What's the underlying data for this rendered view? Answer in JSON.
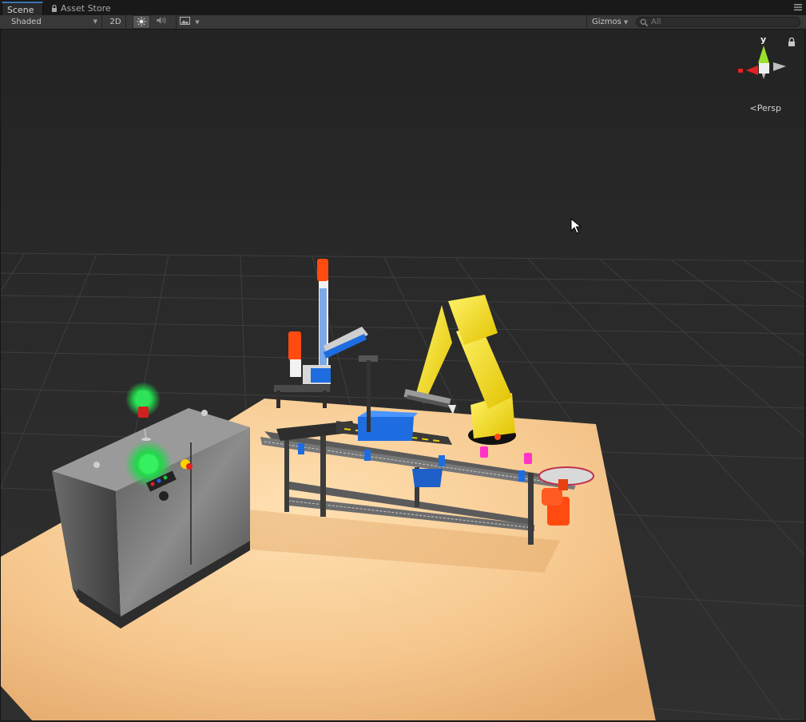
{
  "tabs": {
    "scene": "Scene",
    "asset_store": "Asset Store"
  },
  "toolbar": {
    "shading_mode": "Shaded",
    "mode_2d": "2D",
    "gizmos": "Gizmos",
    "search_placeholder": "All"
  },
  "scene_gizmo": {
    "axis_label": "y",
    "projection": "Persp"
  },
  "colors": {
    "robot": "#f5e000",
    "accent_orange": "#ff4a10",
    "bin_blue": "#1e6de0",
    "floor": "#f3bd80",
    "signal_green": "#22e04a"
  }
}
